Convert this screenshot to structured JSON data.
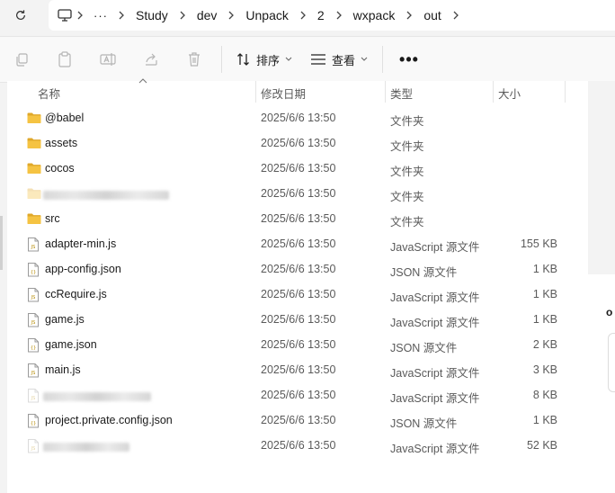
{
  "breadcrumb": [
    "Study",
    "dev",
    "Unpack",
    "2",
    "wxpack",
    "out"
  ],
  "toolbar": {
    "sort_label": "排序",
    "view_label": "查看",
    "more_label": "•••"
  },
  "columns": {
    "name": "名称",
    "date": "修改日期",
    "type": "类型",
    "size": "大小"
  },
  "side": {
    "text": "o"
  },
  "files": [
    {
      "name": "@babel",
      "date": "2025/6/6 13:50",
      "type": "文件夹",
      "size": "",
      "icon": "folder-icon",
      "obscured": false
    },
    {
      "name": "assets",
      "date": "2025/6/6 13:50",
      "type": "文件夹",
      "size": "",
      "icon": "folder-icon",
      "obscured": false
    },
    {
      "name": "cocos",
      "date": "2025/6/6 13:50",
      "type": "文件夹",
      "size": "",
      "icon": "folder-icon",
      "obscured": false
    },
    {
      "name": "",
      "date": "2025/6/6 13:50",
      "type": "文件夹",
      "size": "",
      "icon": "folder-icon",
      "obscured": true
    },
    {
      "name": "src",
      "date": "2025/6/6 13:50",
      "type": "文件夹",
      "size": "",
      "icon": "folder-icon",
      "obscured": false
    },
    {
      "name": "adapter-min.js",
      "date": "2025/6/6 13:50",
      "type": "JavaScript 源文件",
      "size": "155 KB",
      "icon": "js-file-icon",
      "obscured": false
    },
    {
      "name": "app-config.json",
      "date": "2025/6/6 13:50",
      "type": "JSON 源文件",
      "size": "1 KB",
      "icon": "json-file-icon",
      "obscured": false
    },
    {
      "name": "ccRequire.js",
      "date": "2025/6/6 13:50",
      "type": "JavaScript 源文件",
      "size": "1 KB",
      "icon": "js-file-icon",
      "obscured": false
    },
    {
      "name": "game.js",
      "date": "2025/6/6 13:50",
      "type": "JavaScript 源文件",
      "size": "1 KB",
      "icon": "js-file-icon",
      "obscured": false
    },
    {
      "name": "game.json",
      "date": "2025/6/6 13:50",
      "type": "JSON 源文件",
      "size": "2 KB",
      "icon": "json-file-icon",
      "obscured": false
    },
    {
      "name": "main.js",
      "date": "2025/6/6 13:50",
      "type": "JavaScript 源文件",
      "size": "3 KB",
      "icon": "js-file-icon",
      "obscured": false
    },
    {
      "name": "",
      "date": "2025/6/6 13:50",
      "type": "JavaScript 源文件",
      "size": "8 KB",
      "icon": "js-file-icon",
      "obscured": true
    },
    {
      "name": "project.private.config.json",
      "date": "2025/6/6 13:50",
      "type": "JSON 源文件",
      "size": "1 KB",
      "icon": "json-file-icon",
      "obscured": false
    },
    {
      "name": "",
      "date": "2025/6/6 13:50",
      "type": "JavaScript 源文件",
      "size": "52 KB",
      "icon": "js-file-icon",
      "obscured": true
    }
  ],
  "colors": {
    "folder": "#f5c342",
    "folder_dark": "#e0a82a",
    "accent": "#0067c0"
  }
}
